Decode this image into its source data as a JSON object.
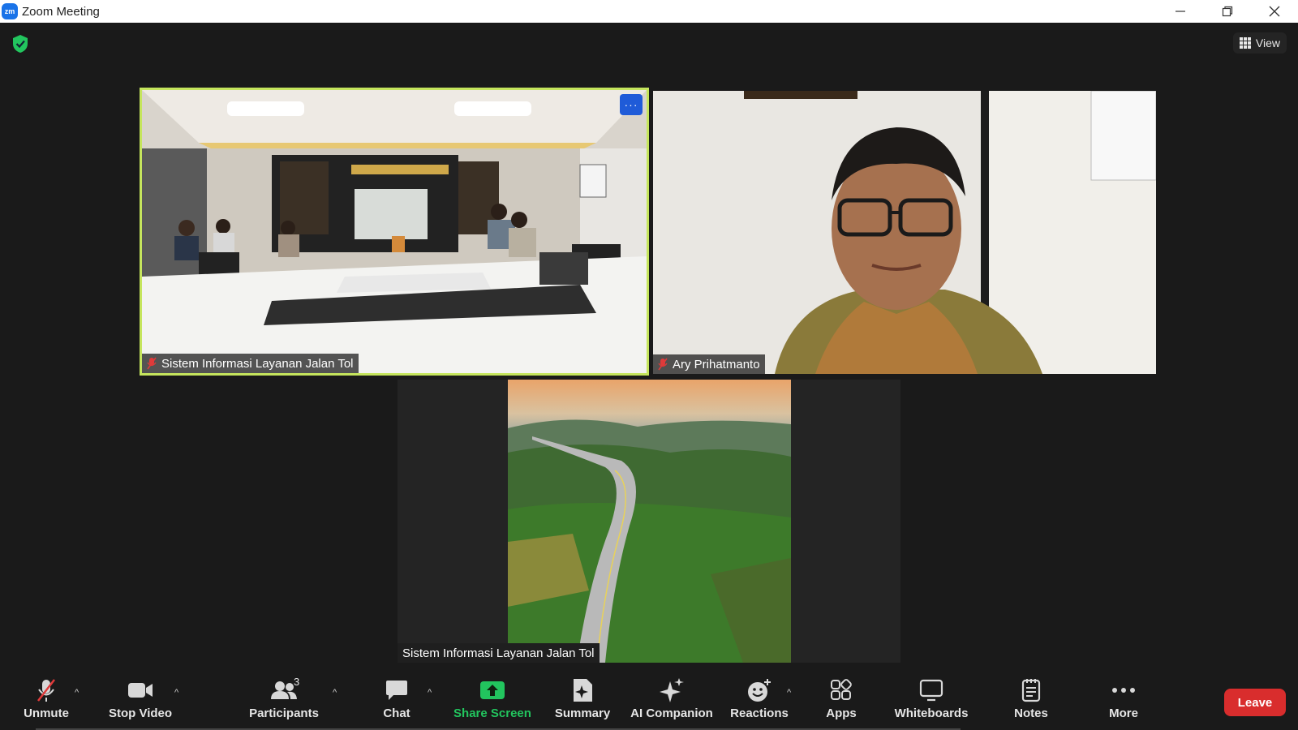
{
  "window": {
    "app_logo": "zm",
    "title": "Zoom Meeting"
  },
  "topbar": {
    "view_label": "View",
    "shield_color": "#22c55e"
  },
  "tiles": [
    {
      "name": "Sistem Informasi Layanan Jalan Tol",
      "muted": true,
      "active_speaker": true,
      "more_label": "···"
    },
    {
      "name": "Ary Prihatmanto",
      "muted": true
    },
    {
      "name": "Sistem Informasi Layanan Jalan Tol",
      "muted": false
    }
  ],
  "toolbar": {
    "unmute": "Unmute",
    "stop_video": "Stop Video",
    "participants": "Participants",
    "participants_count": "3",
    "chat": "Chat",
    "share_screen": "Share Screen",
    "summary": "Summary",
    "ai_companion": "AI Companion",
    "reactions": "Reactions",
    "apps": "Apps",
    "whiteboards": "Whiteboards",
    "notes": "Notes",
    "more": "More",
    "leave": "Leave"
  },
  "colors": {
    "accent_border": "#c5e55d",
    "share_green": "#22c55e",
    "leave_red": "#d92d2d",
    "muted_red": "#e03a3a"
  }
}
